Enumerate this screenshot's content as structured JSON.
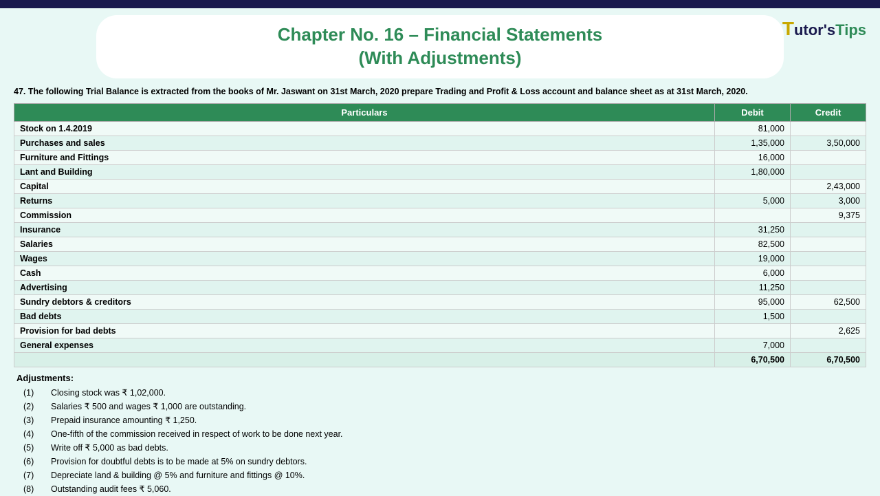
{
  "topbar": {},
  "header": {
    "title_line1": "Chapter No. 16 – Financial Statements",
    "title_line2": "(With Adjustments)",
    "logo_t": "T",
    "logo_tutor": "utor's",
    "logo_tips": "Tips"
  },
  "question": {
    "text": "47. The following Trial Balance is extracted from the books of Mr. Jaswant on 31st March, 2020 prepare Trading and Profit & Loss account and balance sheet as at 31st March, 2020."
  },
  "table": {
    "headers": [
      "Particulars",
      "Debit",
      "Credit"
    ],
    "rows": [
      {
        "particulars": "Stock on 1.4.2019",
        "debit": "81,000",
        "credit": ""
      },
      {
        "particulars": "Purchases and sales",
        "debit": "1,35,000",
        "credit": "3,50,000"
      },
      {
        "particulars": "Furniture and Fittings",
        "debit": "16,000",
        "credit": ""
      },
      {
        "particulars": "Lant and Building",
        "debit": "1,80,000",
        "credit": ""
      },
      {
        "particulars": "Capital",
        "debit": "",
        "credit": "2,43,000"
      },
      {
        "particulars": "Returns",
        "debit": "5,000",
        "credit": "3,000"
      },
      {
        "particulars": "Commission",
        "debit": "",
        "credit": "9,375"
      },
      {
        "particulars": "Insurance",
        "debit": "31,250",
        "credit": ""
      },
      {
        "particulars": "Salaries",
        "debit": "82,500",
        "credit": ""
      },
      {
        "particulars": "Wages",
        "debit": "19,000",
        "credit": ""
      },
      {
        "particulars": "Cash",
        "debit": "6,000",
        "credit": ""
      },
      {
        "particulars": "Advertising",
        "debit": "11,250",
        "credit": ""
      },
      {
        "particulars": "Sundry debtors & creditors",
        "debit": "95,000",
        "credit": "62,500"
      },
      {
        "particulars": "Bad debts",
        "debit": "1,500",
        "credit": ""
      },
      {
        "particulars": "Provision for bad debts",
        "debit": "",
        "credit": "2,625"
      },
      {
        "particulars": "General expenses",
        "debit": "7,000",
        "credit": ""
      }
    ],
    "total_row": {
      "particulars": "",
      "debit": "6,70,500",
      "credit": "6,70,500"
    }
  },
  "adjustments": {
    "title": "Adjustments:",
    "items": [
      {
        "num": "(1)",
        "text": "Closing stock was ₹ 1,02,000."
      },
      {
        "num": "(2)",
        "text": "Salaries ₹ 500  and wages ₹ 1,000  are outstanding."
      },
      {
        "num": "(3)",
        "text": "Prepaid insurance amounting ₹ 1,250."
      },
      {
        "num": "(4)",
        "text": "One-fifth of the commission received in respect of work to be done next year."
      },
      {
        "num": "(5)",
        "text": "Write off ₹ 5,000  as bad debts."
      },
      {
        "num": "(6)",
        "text": "Provision for doubtful debts is to be made at 5% on sundry debtors."
      },
      {
        "num": "(7)",
        "text": "Depreciate land & building @ 5%  and furniture and fittings @ 10%."
      },
      {
        "num": "(8)",
        "text": "Outstanding audit fees ₹ 5,060."
      }
    ]
  }
}
